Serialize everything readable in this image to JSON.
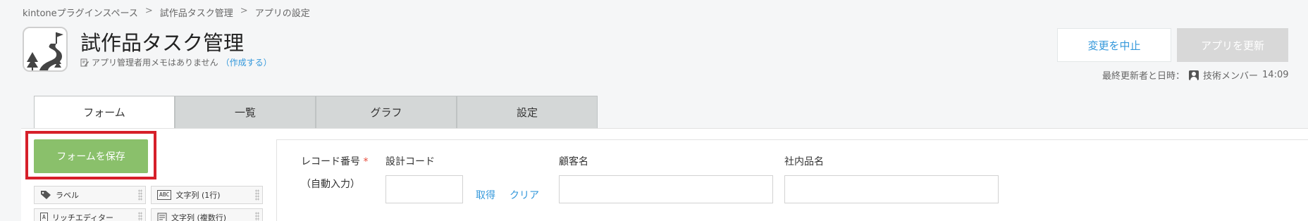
{
  "breadcrumb": {
    "items": [
      "kintoneプラグインスペース",
      "試作品タスク管理",
      "アプリの設定"
    ],
    "separator": ">"
  },
  "app": {
    "title": "試作品タスク管理",
    "memo_text": "アプリ管理者用メモはありません",
    "memo_link": "（作成する）"
  },
  "actions": {
    "cancel_label": "変更を中止",
    "update_label": "アプリを更新"
  },
  "last_updated": {
    "label": "最終更新者と日時：",
    "user": "技術メンバー",
    "time": "14:09"
  },
  "tabs": [
    {
      "label": "フォーム",
      "active": true
    },
    {
      "label": "一覧",
      "active": false
    },
    {
      "label": "グラフ",
      "active": false
    },
    {
      "label": "設定",
      "active": false
    }
  ],
  "form_editor": {
    "save_label": "フォームを保存",
    "palette": [
      {
        "label": "ラベル",
        "icon": "tag-icon"
      },
      {
        "label": "文字列 (1行)",
        "icon": "abc-icon",
        "icon_text": "ABC"
      },
      {
        "label": "リッチエディター",
        "icon": "rich-editor-icon",
        "icon_text": "A"
      },
      {
        "label": "文字列 (複数行)",
        "icon": "multiline-icon"
      }
    ]
  },
  "form_fields": {
    "record_number": {
      "label": "レコード番号",
      "required_mark": "*",
      "value": "（自動入力）"
    },
    "design_code": {
      "label": "設計コード",
      "fetch": "取得",
      "clear": "クリア"
    },
    "customer_name": {
      "label": "顧客名"
    },
    "internal_product": {
      "label": "社内品名"
    }
  },
  "colors": {
    "accent": "#3498db",
    "save_button": "#8ac06b",
    "highlight": "#d6202a",
    "required": "#e74c3c"
  }
}
